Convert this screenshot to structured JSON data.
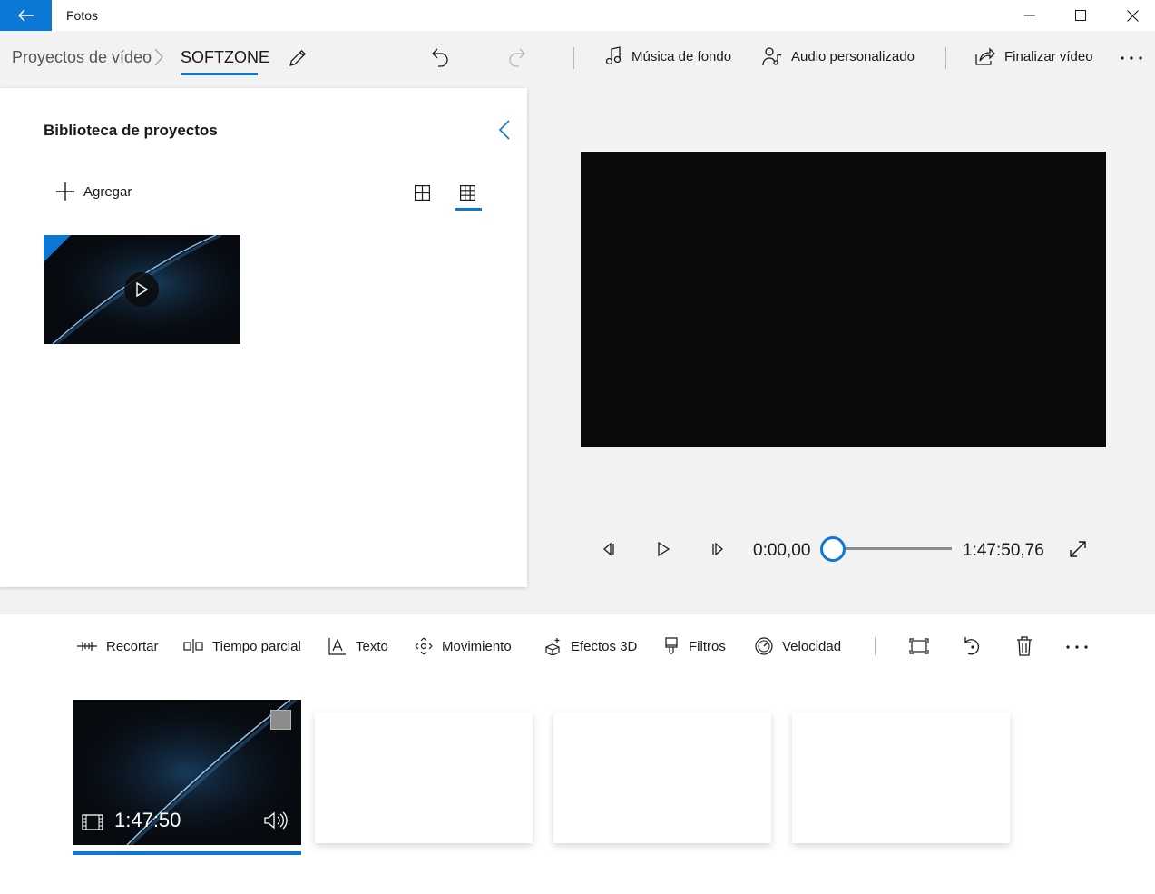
{
  "titlebar": {
    "app_title": "Fotos",
    "back_icon": "arrow-left-icon",
    "accent": "#0a78d4"
  },
  "breadcrumb": {
    "root": "Proyectos de vídeo",
    "current": "SOFTZONE"
  },
  "commands": {
    "background_music": "Música de fondo",
    "custom_audio": "Audio personalizado",
    "finish_video": "Finalizar vídeo"
  },
  "library": {
    "title": "Biblioteca de proyectos",
    "add_label": "Agregar"
  },
  "player": {
    "current_time": "0:00,00",
    "total_time": "1:47:50,76",
    "progress": 0
  },
  "toolbar": {
    "trim": "Recortar",
    "split": "Tiempo parcial",
    "text": "Texto",
    "motion": "Movimiento",
    "effects_3d": "Efectos 3D",
    "filters": "Filtros",
    "speed": "Velocidad"
  },
  "storyboard": {
    "clips": [
      {
        "duration": "1:47:50",
        "selected": true
      }
    ],
    "empty_slots": 3
  }
}
